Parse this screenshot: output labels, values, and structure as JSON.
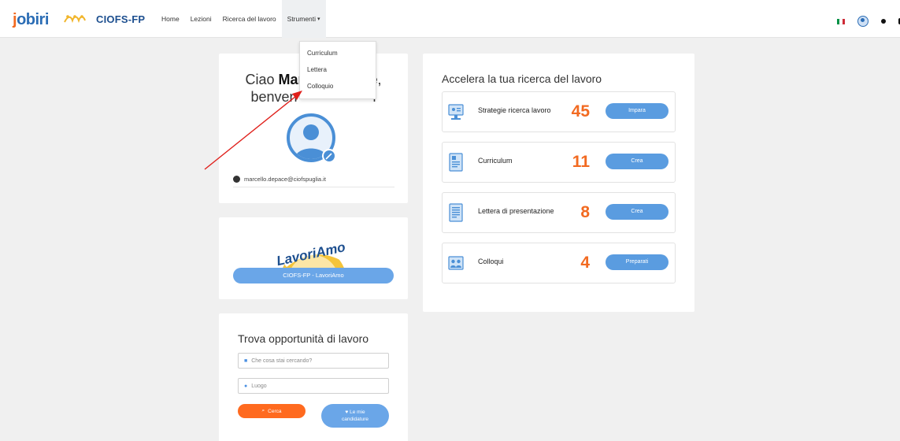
{
  "brand": {
    "jobiri": "jobiri",
    "ciofs": "CIOFS-FP"
  },
  "nav": {
    "items": [
      "Home",
      "Lezioni",
      "Ricerca del lavoro"
    ],
    "strumenti": "Strumenti",
    "dropdown": [
      "Curriculum",
      "Lettera",
      "Colloquio"
    ]
  },
  "topright": {
    "flag_colors": [
      "#009246",
      "#ffffff",
      "#ce2b37"
    ]
  },
  "profile": {
    "greeting_line1_prefix": "Ciao ",
    "name_visible_start": "Marc",
    "name_visible_end": "e",
    "greeting_line1_suffix": ",",
    "greeting_line2_start": "benven",
    "greeting_line2_end": "i",
    "email": "marcello.depace@ciofspuglia.it"
  },
  "lavoriamo": {
    "logo_text": "LavoriAmo",
    "button": "CIOFS-FP - LavoriAmo"
  },
  "trova": {
    "title": "Trova opportunità di lavoro",
    "search_placeholder": "Che cosa stai cercando?",
    "place_placeholder": "Luogo",
    "cerca": "Cerca",
    "candidature_line1": "Le mie",
    "candidature_line2": "candidature"
  },
  "accel": {
    "title": "Accelera la tua ricerca del lavoro",
    "features": [
      {
        "label": "Strategie ricerca lavoro",
        "count": "45",
        "button": "Impara",
        "icon": "monitor-icon"
      },
      {
        "label": "Curriculum",
        "count": "11",
        "button": "Crea",
        "icon": "document-icon"
      },
      {
        "label": "Lettera di presentazione",
        "count": "8",
        "button": "Crea",
        "icon": "letter-icon"
      },
      {
        "label": "Colloqui",
        "count": "4",
        "button": "Preparati",
        "icon": "interview-icon"
      }
    ]
  },
  "colors": {
    "accent_blue": "#5a9ce0",
    "accent_orange": "#f26a21",
    "annotation_red": "#e0201b"
  }
}
